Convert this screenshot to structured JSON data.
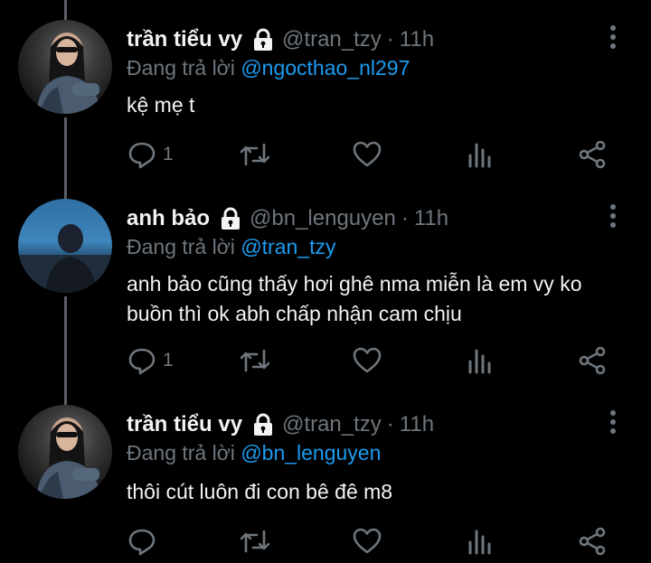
{
  "tweets": [
    {
      "name": "trần tiểu vy",
      "handle": "@tran_tzy",
      "dot": "·",
      "time": "11h",
      "reply_prefix": "Đang trả lời",
      "reply_to": "@ngocthao_nl297",
      "text": "kệ mẹ t",
      "reply_count": "1",
      "avatar": "avatar-vy",
      "lock_icon": "lock-icon"
    },
    {
      "name": "anh bảo",
      "handle": "@bn_lenguyen",
      "dot": "·",
      "time": "11h",
      "reply_prefix": "Đang trả lời",
      "reply_to": "@tran_tzy",
      "text": "anh bảo cũng thấy hơi ghê nma miễn là em vy ko buồn thì ok abh chấp nhận cam chịu",
      "reply_count": "1",
      "avatar": "avatar-bao",
      "lock_icon": "lock-icon"
    },
    {
      "name": "trần tiểu vy",
      "handle": "@tran_tzy",
      "dot": "·",
      "time": "11h",
      "reply_prefix": "Đang trả lời",
      "reply_to": "@bn_lenguyen",
      "text": "thôi cút luôn đi con bê đê m8",
      "reply_count": "",
      "avatar": "avatar-vy",
      "lock_icon": "lock-icon"
    }
  ],
  "colors": {
    "background": "#000000",
    "text": "#e7e9ea",
    "muted": "#6e767d",
    "link": "#1d9bf0",
    "thread_line": "#5b6066"
  },
  "icons": [
    "reply-icon",
    "retweet-icon",
    "like-icon",
    "analytics-icon",
    "share-icon",
    "more-icon",
    "lock-icon"
  ]
}
